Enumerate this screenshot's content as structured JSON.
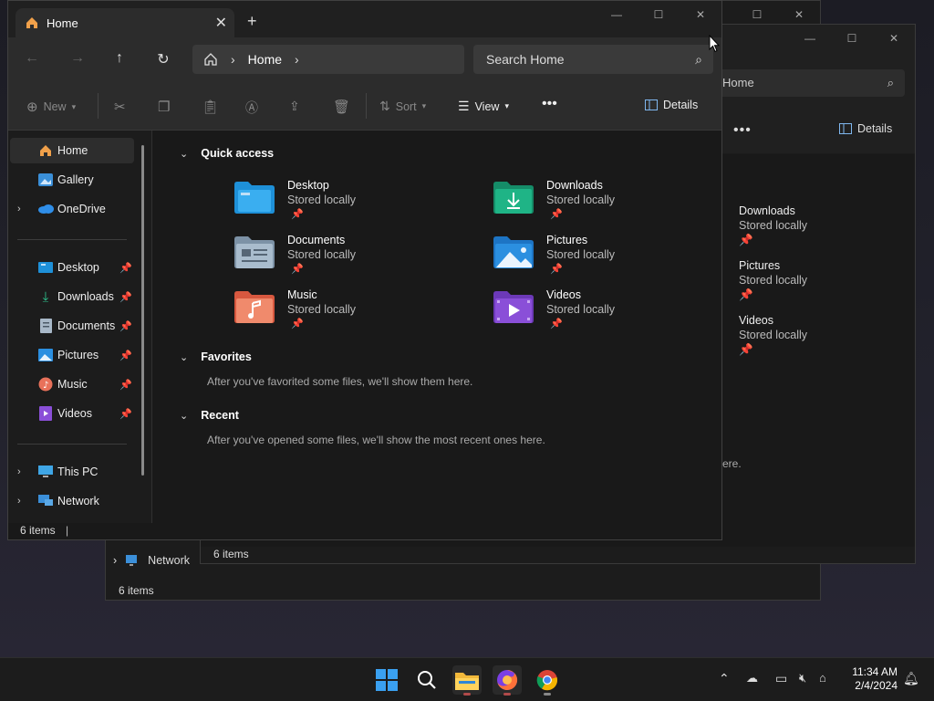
{
  "back_window": {
    "network_label": "Network",
    "status": "6 items"
  },
  "mid_window": {
    "search_text": "Home",
    "more_label": "•••",
    "details_label": "Details",
    "items": [
      {
        "name": "Downloads",
        "sub": "Stored locally"
      },
      {
        "name": "Pictures",
        "sub": "Stored locally"
      },
      {
        "name": "Videos",
        "sub": "Stored locally"
      }
    ],
    "hint_fragment": "ere.",
    "status": "6 items"
  },
  "main_window": {
    "tab_title": "Home",
    "address": {
      "location": "Home"
    },
    "search_placeholder": "Search Home",
    "commands": {
      "new": "New",
      "sort": "Sort",
      "view": "View",
      "more": "•••",
      "details": "Details"
    },
    "nav": {
      "top": [
        {
          "label": "Home",
          "icon": "home-icon"
        },
        {
          "label": "Gallery",
          "icon": "gallery-icon"
        },
        {
          "label": "OneDrive",
          "icon": "onedrive-icon"
        }
      ],
      "pinned": [
        {
          "label": "Desktop",
          "icon": "desktop-folder-icon"
        },
        {
          "label": "Downloads",
          "icon": "downloads-icon"
        },
        {
          "label": "Documents",
          "icon": "documents-icon"
        },
        {
          "label": "Pictures",
          "icon": "pictures-icon"
        },
        {
          "label": "Music",
          "icon": "music-icon"
        },
        {
          "label": "Videos",
          "icon": "videos-icon"
        }
      ],
      "bottom": [
        {
          "label": "This PC",
          "icon": "this-pc-icon"
        },
        {
          "label": "Network",
          "icon": "network-icon"
        }
      ]
    },
    "sections": {
      "quick_access": "Quick access",
      "favorites": "Favorites",
      "favorites_hint": "After you've favorited some files, we'll show them here.",
      "recent": "Recent",
      "recent_hint": "After you've opened some files, we'll show the most recent ones here."
    },
    "quick_access": [
      {
        "name": "Desktop",
        "sub": "Stored locally",
        "color": "#1e90d8"
      },
      {
        "name": "Downloads",
        "sub": "Stored locally",
        "color": "#1aa37a"
      },
      {
        "name": "Documents",
        "sub": "Stored locally",
        "color": "#8ea4b8"
      },
      {
        "name": "Pictures",
        "sub": "Stored locally",
        "color": "#2b8fe0"
      },
      {
        "name": "Music",
        "sub": "Stored locally",
        "color": "#e8715a"
      },
      {
        "name": "Videos",
        "sub": "Stored locally",
        "color": "#8a4fd8"
      }
    ],
    "status": "6 items"
  },
  "taskbar": {
    "time": "11:34 AM",
    "date": "2/4/2024"
  }
}
